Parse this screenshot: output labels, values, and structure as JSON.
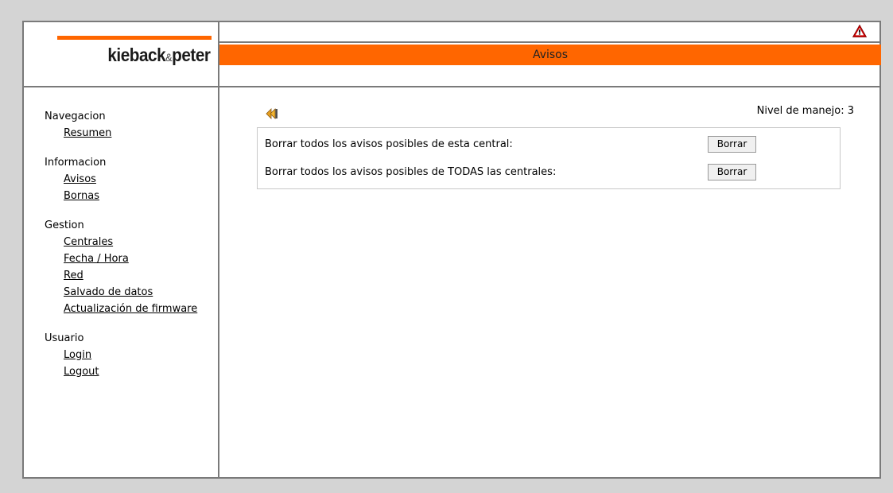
{
  "logo": {
    "part1": "kieback",
    "amp": "&",
    "part2": "peter"
  },
  "header": {
    "title": "Avisos",
    "alert_icon": "warning-icon"
  },
  "sidebar": {
    "groups": [
      {
        "heading": "Navegacion",
        "links": [
          "Resumen"
        ]
      },
      {
        "heading": "Informacion",
        "links": [
          "Avisos",
          "Bornas"
        ]
      },
      {
        "heading": "Gestion",
        "links": [
          "Centrales",
          "Fecha / Hora",
          "Red",
          "Salvado de datos",
          "Actualización de firmware"
        ]
      },
      {
        "heading": "Usuario",
        "links": [
          "Login",
          "Logout"
        ]
      }
    ]
  },
  "main": {
    "back_icon": "first-page-icon",
    "nivel": "Nivel de manejo: 3",
    "rows": [
      {
        "label": "Borrar todos los avisos posibles de esta central:",
        "button": "Borrar"
      },
      {
        "label": "Borrar todos los avisos posibles de TODAS las centrales:",
        "button": "Borrar"
      }
    ]
  },
  "colors": {
    "accent": "#ff6600",
    "border": "#7a7a7a",
    "background": "#d4d4d4"
  }
}
